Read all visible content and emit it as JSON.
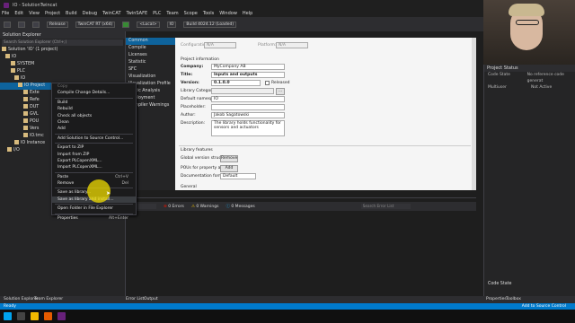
{
  "window": {
    "title": "IO - SolutionTwincat"
  },
  "menu": [
    "File",
    "Edit",
    "View",
    "Project",
    "Build",
    "Debug",
    "TwinCAT",
    "TwinSAFE",
    "PLC",
    "Team",
    "Scope",
    "Tools",
    "Window",
    "Help"
  ],
  "toolbar": {
    "config": "Release",
    "platform": "TwinCAT RT (x64)",
    "target": "<Local>",
    "project": "IO",
    "build": "Build 4024.12 (Loaded)"
  },
  "solution_explorer": {
    "title": "Solution Explorer",
    "search": "Search Solution Explorer (Ctrl+;)",
    "items": [
      "Solution 'IO' (1 project)",
      "IO",
      "SYSTEM",
      "PLC",
      "IO",
      "IO Project",
      "Exte",
      "Refe",
      "DUT",
      "GVL",
      "POU",
      "Vers",
      "IO.tmc",
      "IO Instance",
      "I/O"
    ]
  },
  "categories": [
    "Common",
    "Compile",
    "Licenses",
    "Statistic",
    "SFC",
    "Visualization",
    "Visualization Profile",
    "Static Analysis",
    "Deployment",
    "Compiler Warnings"
  ],
  "props": {
    "configuration_label": "Configuration:",
    "configuration_value": "N/A",
    "platform_label": "Platform:",
    "platform_value": "N/A",
    "project_info": "Project information",
    "company_label": "Company:",
    "company_value": "MyCompany AB",
    "title_label": "Title:",
    "title_value": "Inputs and outputs",
    "version_label": "Version:",
    "version_value": "0.1.0.0",
    "released": "Released",
    "categories_label": "Library Categories:",
    "namespace_label": "Default namespace:",
    "namespace_value": "IO",
    "placeholder_label": "Placeholder:",
    "author_label": "Author:",
    "author_value": "Jakob Sagatowski",
    "description_label": "Description:",
    "description_value": "The library holds functionality for sensors and actuators",
    "library_features": "Library features",
    "global_version_label": "Global version structure",
    "remove_btn": "Remove",
    "pous_label": "POUs for property access:",
    "add_btn": "Add",
    "doc_format_label": "Documentation format:",
    "doc_format_value": "Default",
    "general": "General"
  },
  "context_menu": [
    {
      "label": "Copy",
      "shortcut": "",
      "dim": true
    },
    {
      "label": "Compile Change Details...",
      "shortcut": ""
    },
    {
      "sep": true
    },
    {
      "label": "Build",
      "shortcut": ""
    },
    {
      "label": "Rebuild",
      "shortcut": ""
    },
    {
      "label": "Check all objects",
      "shortcut": ""
    },
    {
      "label": "Clean",
      "shortcut": ""
    },
    {
      "label": "Add",
      "shortcut": ""
    },
    {
      "sep": true
    },
    {
      "label": "Add Solution to Source Control...",
      "shortcut": ""
    },
    {
      "sep": true
    },
    {
      "label": "Export to ZIP",
      "shortcut": ""
    },
    {
      "label": "Import from ZIP",
      "shortcut": ""
    },
    {
      "label": "Export PLCopenXML...",
      "shortcut": ""
    },
    {
      "label": "Import PLCopenXML...",
      "shortcut": ""
    },
    {
      "sep": true
    },
    {
      "label": "Paste",
      "shortcut": "Ctrl+V"
    },
    {
      "label": "Remove",
      "shortcut": "Del"
    },
    {
      "sep": true
    },
    {
      "label": "Save as library...",
      "shortcut": ""
    },
    {
      "label": "Save as library and install...",
      "shortcut": "",
      "hl": true
    },
    {
      "sep": true
    },
    {
      "label": "Open Folder in File Explorer",
      "shortcut": ""
    },
    {
      "sep": true
    },
    {
      "label": "Properties",
      "shortcut": "Alt+Enter"
    }
  ],
  "errlist": {
    "errors": "0 Errors",
    "warnings": "0 Warnings",
    "messages": "0 Messages",
    "search": "Search Error List"
  },
  "right_panel": {
    "title": "Project Status",
    "rows": [
      [
        "Code State",
        "No reference code generat"
      ],
      [
        "Multiuser",
        "Not Active"
      ]
    ],
    "code_state": "Code State"
  },
  "bottom_tabs": {
    "left": [
      "Solution Explorer",
      "Team Explorer"
    ],
    "mid": [
      "Error List",
      "Output"
    ],
    "right": [
      "Properties",
      "Toolbox"
    ]
  },
  "status": {
    "left": "Ready",
    "right": "Add to Source Control"
  }
}
